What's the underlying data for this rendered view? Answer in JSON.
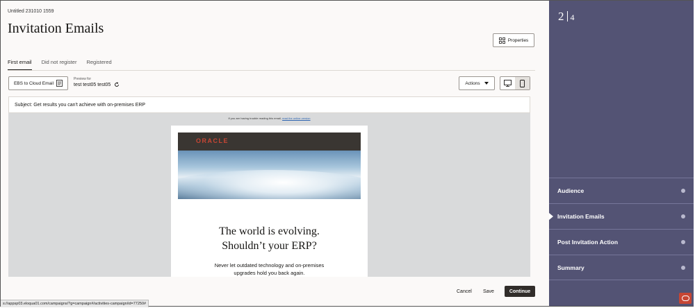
{
  "breadcrumb": "Untitled 231010 1559",
  "page_title": "Invitation Emails",
  "properties_label": "Properties",
  "tabs": [
    {
      "label": "First email"
    },
    {
      "label": "Did not register"
    },
    {
      "label": "Registered"
    }
  ],
  "email_selector": "EBS to Cloud Email",
  "preview": {
    "label": "Preview for",
    "name": "test test05 test05"
  },
  "actions_label": "Actions",
  "subject": "Subject: Get results you can't achieve with on-premises ERP",
  "trouble_text": "If you are having trouble reading this email,",
  "trouble_link": "read the online version",
  "email": {
    "logo": "ORACLE",
    "headline_1": "The world is evolving.",
    "headline_2": "Shouldn’t your ERP?",
    "body_1": "Never let outdated technology and on-premises",
    "body_2": "upgrades hold you back again."
  },
  "footer": {
    "cancel": "Cancel",
    "save": "Save",
    "continue": "Continue"
  },
  "status_url": "s://appsp03.eloqua01.com/campaigns/?g=campaign#/activities-campaign/id=77250#",
  "stepper": {
    "current": "2",
    "total": "4"
  },
  "sidebar": {
    "items": [
      {
        "label": "Audience"
      },
      {
        "label": "Invitation Emails"
      },
      {
        "label": "Post Invitation Action"
      },
      {
        "label": "Summary"
      }
    ]
  },
  "colors": {
    "sidebar_bg": "#535374",
    "brand_red": "#c74634",
    "primary_btn": "#312d2a"
  }
}
